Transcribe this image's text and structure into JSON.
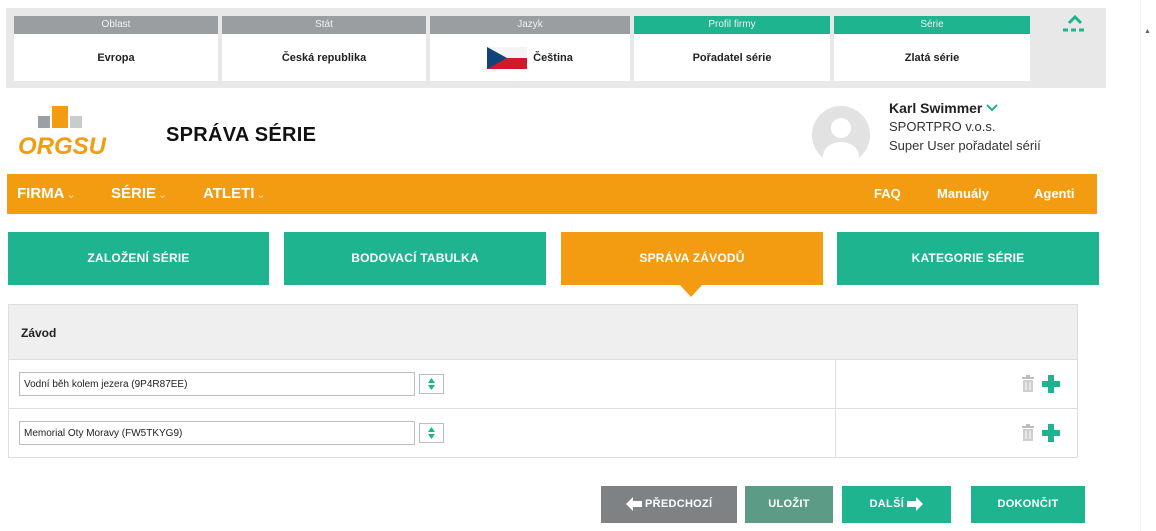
{
  "context_bar": [
    {
      "header": "Oblast",
      "value": "Evropa",
      "active": false
    },
    {
      "header": "Stát",
      "value": "Česká republika",
      "active": false
    },
    {
      "header": "Jazyk",
      "value": "Čeština",
      "active": false,
      "icon": "czech-flag-icon"
    },
    {
      "header": "Profil firmy",
      "value": "Pořadatel série",
      "active": true
    },
    {
      "header": "Série",
      "value": "Zlatá série",
      "active": true
    }
  ],
  "header": {
    "logo_text": "ORGSU",
    "page_title": "SPRÁVA SÉRIE",
    "user": {
      "name": "Karl Swimmer",
      "company": "SPORTPRO v.o.s.",
      "role": "Super User pořadatel sérií"
    }
  },
  "nav": {
    "left": [
      {
        "label": "FIRMA",
        "caret": "⌄"
      },
      {
        "label": "SÉRIE",
        "caret": "⌄"
      },
      {
        "label": "ATLETI",
        "caret": "⌄"
      }
    ],
    "right": [
      "FAQ",
      "Manuály",
      "Agenti"
    ]
  },
  "tabs": [
    {
      "label": "ZALOŽENÍ SÉRIE",
      "active": false
    },
    {
      "label": "BODOVACÍ TABULKA",
      "active": false
    },
    {
      "label": "SPRÁVA ZÁVODŮ",
      "active": true
    },
    {
      "label": "KATEGORIE SÉRIE",
      "active": false
    }
  ],
  "race_table": {
    "header": "Závod",
    "rows": [
      {
        "value": "Vodní běh kolem jezera (9P4R87EE)"
      },
      {
        "value": "Memorial Oty Moravy (FW5TKYG9)"
      }
    ]
  },
  "buttons": {
    "prev": "PŘEDCHOZÍ",
    "save": "ULOŽIT",
    "next": "DALŠÍ",
    "finish": "DOKONČIT"
  },
  "colors": {
    "accent_green": "#1eb48f",
    "accent_orange": "#f39c12",
    "inactive_grey": "#9a9ea1"
  }
}
